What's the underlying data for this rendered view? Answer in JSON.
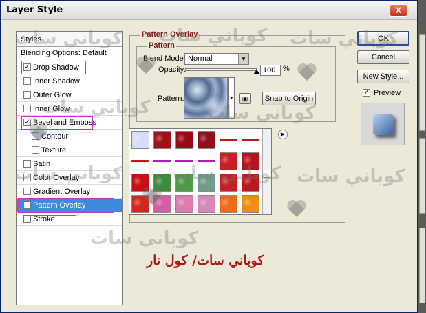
{
  "window": {
    "title": "Layer Style",
    "close_label": "X"
  },
  "styles_panel": {
    "header": "Styles",
    "blending_options": "Blending Options: Default",
    "items": [
      {
        "label": "Drop Shadow",
        "checked": true
      },
      {
        "label": "Inner Shadow",
        "checked": false
      },
      {
        "label": "Outer Glow",
        "checked": false
      },
      {
        "label": "Inner Glow",
        "checked": false
      },
      {
        "label": "Bevel and Emboss",
        "checked": true
      },
      {
        "label": "Contour",
        "checked": false
      },
      {
        "label": "Texture",
        "checked": false
      },
      {
        "label": "Satin",
        "checked": false
      },
      {
        "label": "Color Overlay",
        "checked": false
      },
      {
        "label": "Gradient Overlay",
        "checked": false
      },
      {
        "label": "Pattern Overlay",
        "checked": true
      },
      {
        "label": "Stroke",
        "checked": false
      }
    ]
  },
  "pattern_overlay": {
    "group_title": "Pattern Overlay",
    "subgroup_title": "Pattern",
    "blend_mode_label": "Blend Mode:",
    "blend_mode_value": "Normal",
    "opacity_label": "Opacity:",
    "opacity_value": "100",
    "opacity_unit": "%",
    "opacity_fraction": 1.0,
    "pattern_label": "Pattern:",
    "snap_button": "Snap to Origin"
  },
  "buttons": {
    "ok": "OK",
    "cancel": "Cancel",
    "new_style": "New Style...",
    "preview": "Preview",
    "preview_checked": true
  },
  "watermark": {
    "text": "كوباني سات",
    "caption": "كوباني سات/ كول نار"
  },
  "colors": {
    "selected": "#3d8bdc",
    "highlight": "#c82fd0",
    "group_title": "#7a1a1a"
  }
}
